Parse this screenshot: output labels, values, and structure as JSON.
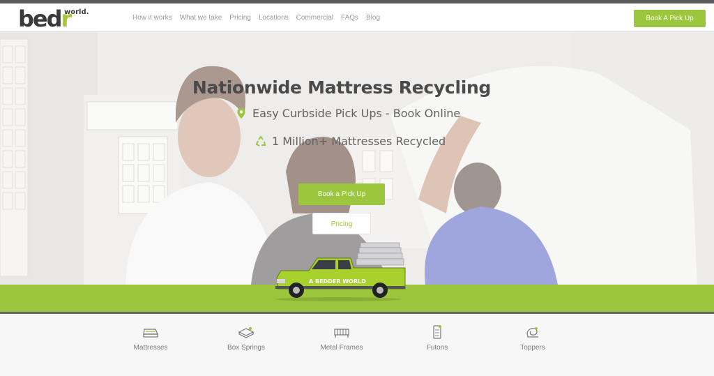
{
  "header": {
    "logo_main": "bed",
    "logo_accent": "r",
    "logo_sub": "world.",
    "nav": [
      "How it works",
      "What we take",
      "Pricing",
      "Locations",
      "Commercial",
      "FAQs",
      "Blog"
    ],
    "cta_label": "Book A Pick Up"
  },
  "hero": {
    "title": "Nationwide Mattress Recycling",
    "features": [
      {
        "icon": "map-pin-icon",
        "text": "Easy Curbside Pick Ups - Book Online"
      },
      {
        "icon": "recycle-icon",
        "text": "1 Million+ Mattresses Recycled"
      }
    ],
    "primary_button": "Book a Pick Up",
    "secondary_button": "Pricing",
    "truck_text": "A BEDDER WORLD"
  },
  "categories": [
    {
      "icon": "mattress-icon",
      "label": "Mattresses"
    },
    {
      "icon": "box-spring-icon",
      "label": "Box Springs"
    },
    {
      "icon": "metal-frame-icon",
      "label": "Metal Frames"
    },
    {
      "icon": "futon-icon",
      "label": "Futons"
    },
    {
      "icon": "topper-icon",
      "label": "Toppers"
    }
  ],
  "colors": {
    "accent": "#9cc63e",
    "text_dark": "#4a4a4a",
    "header_bar": "#5a5a5a",
    "divider": "#666666"
  }
}
